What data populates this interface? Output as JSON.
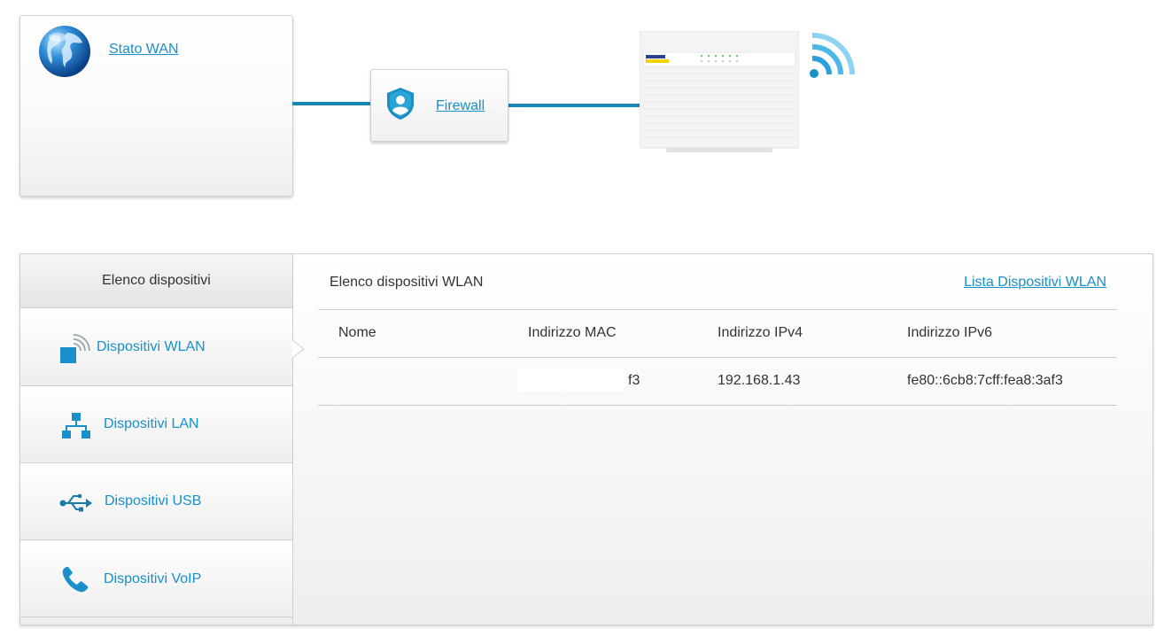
{
  "topology": {
    "wan_label": "Stato WAN",
    "firewall_label": "Firewall"
  },
  "sidebar": {
    "header": "Elenco dispositivi",
    "items": [
      {
        "label": "Dispositivi WLAN",
        "icon": "wlan-icon"
      },
      {
        "label": "Dispositivi LAN",
        "icon": "lan-network-icon"
      },
      {
        "label": "Dispositivi USB",
        "icon": "usb-icon"
      },
      {
        "label": "Dispositivi VoIP",
        "icon": "phone-icon"
      }
    ]
  },
  "content": {
    "title": "Elenco dispositivi WLAN",
    "link": "Lista Dispositivi WLAN",
    "columns": [
      "Nome",
      "Indirizzo MAC",
      "Indirizzo IPv4",
      "Indirizzo IPv6"
    ],
    "rows": [
      {
        "nome": "",
        "mac": "f3",
        "ipv4": "192.168.1.43",
        "ipv6": "fe80::6cb8:7cff:fea8:3af3"
      }
    ]
  },
  "colors": {
    "accent": "#1a8fc9",
    "wire": "#1a87b9"
  }
}
